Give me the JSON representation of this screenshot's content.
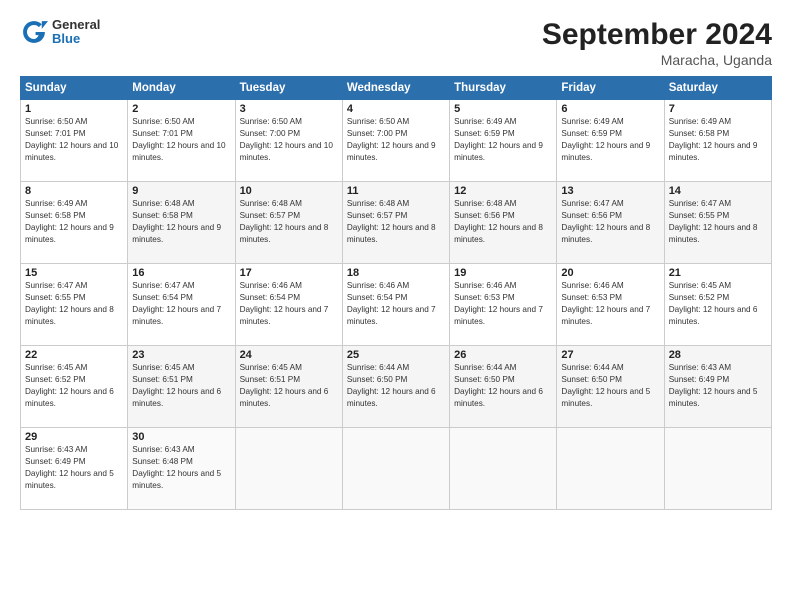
{
  "header": {
    "logo_general": "General",
    "logo_blue": "Blue",
    "month_title": "September 2024",
    "subtitle": "Maracha, Uganda"
  },
  "columns": [
    "Sunday",
    "Monday",
    "Tuesday",
    "Wednesday",
    "Thursday",
    "Friday",
    "Saturday"
  ],
  "weeks": [
    [
      {
        "day": "1",
        "sr": "6:50 AM",
        "ss": "7:01 PM",
        "dl": "12 hours and 10 minutes."
      },
      {
        "day": "2",
        "sr": "6:50 AM",
        "ss": "7:01 PM",
        "dl": "12 hours and 10 minutes."
      },
      {
        "day": "3",
        "sr": "6:50 AM",
        "ss": "7:00 PM",
        "dl": "12 hours and 10 minutes."
      },
      {
        "day": "4",
        "sr": "6:50 AM",
        "ss": "7:00 PM",
        "dl": "12 hours and 9 minutes."
      },
      {
        "day": "5",
        "sr": "6:49 AM",
        "ss": "6:59 PM",
        "dl": "12 hours and 9 minutes."
      },
      {
        "day": "6",
        "sr": "6:49 AM",
        "ss": "6:59 PM",
        "dl": "12 hours and 9 minutes."
      },
      {
        "day": "7",
        "sr": "6:49 AM",
        "ss": "6:58 PM",
        "dl": "12 hours and 9 minutes."
      }
    ],
    [
      {
        "day": "8",
        "sr": "6:49 AM",
        "ss": "6:58 PM",
        "dl": "12 hours and 9 minutes."
      },
      {
        "day": "9",
        "sr": "6:48 AM",
        "ss": "6:58 PM",
        "dl": "12 hours and 9 minutes."
      },
      {
        "day": "10",
        "sr": "6:48 AM",
        "ss": "6:57 PM",
        "dl": "12 hours and 8 minutes."
      },
      {
        "day": "11",
        "sr": "6:48 AM",
        "ss": "6:57 PM",
        "dl": "12 hours and 8 minutes."
      },
      {
        "day": "12",
        "sr": "6:48 AM",
        "ss": "6:56 PM",
        "dl": "12 hours and 8 minutes."
      },
      {
        "day": "13",
        "sr": "6:47 AM",
        "ss": "6:56 PM",
        "dl": "12 hours and 8 minutes."
      },
      {
        "day": "14",
        "sr": "6:47 AM",
        "ss": "6:55 PM",
        "dl": "12 hours and 8 minutes."
      }
    ],
    [
      {
        "day": "15",
        "sr": "6:47 AM",
        "ss": "6:55 PM",
        "dl": "12 hours and 8 minutes."
      },
      {
        "day": "16",
        "sr": "6:47 AM",
        "ss": "6:54 PM",
        "dl": "12 hours and 7 minutes."
      },
      {
        "day": "17",
        "sr": "6:46 AM",
        "ss": "6:54 PM",
        "dl": "12 hours and 7 minutes."
      },
      {
        "day": "18",
        "sr": "6:46 AM",
        "ss": "6:54 PM",
        "dl": "12 hours and 7 minutes."
      },
      {
        "day": "19",
        "sr": "6:46 AM",
        "ss": "6:53 PM",
        "dl": "12 hours and 7 minutes."
      },
      {
        "day": "20",
        "sr": "6:46 AM",
        "ss": "6:53 PM",
        "dl": "12 hours and 7 minutes."
      },
      {
        "day": "21",
        "sr": "6:45 AM",
        "ss": "6:52 PM",
        "dl": "12 hours and 6 minutes."
      }
    ],
    [
      {
        "day": "22",
        "sr": "6:45 AM",
        "ss": "6:52 PM",
        "dl": "12 hours and 6 minutes."
      },
      {
        "day": "23",
        "sr": "6:45 AM",
        "ss": "6:51 PM",
        "dl": "12 hours and 6 minutes."
      },
      {
        "day": "24",
        "sr": "6:45 AM",
        "ss": "6:51 PM",
        "dl": "12 hours and 6 minutes."
      },
      {
        "day": "25",
        "sr": "6:44 AM",
        "ss": "6:50 PM",
        "dl": "12 hours and 6 minutes."
      },
      {
        "day": "26",
        "sr": "6:44 AM",
        "ss": "6:50 PM",
        "dl": "12 hours and 6 minutes."
      },
      {
        "day": "27",
        "sr": "6:44 AM",
        "ss": "6:50 PM",
        "dl": "12 hours and 5 minutes."
      },
      {
        "day": "28",
        "sr": "6:43 AM",
        "ss": "6:49 PM",
        "dl": "12 hours and 5 minutes."
      }
    ],
    [
      {
        "day": "29",
        "sr": "6:43 AM",
        "ss": "6:49 PM",
        "dl": "12 hours and 5 minutes."
      },
      {
        "day": "30",
        "sr": "6:43 AM",
        "ss": "6:48 PM",
        "dl": "12 hours and 5 minutes."
      },
      null,
      null,
      null,
      null,
      null
    ]
  ]
}
